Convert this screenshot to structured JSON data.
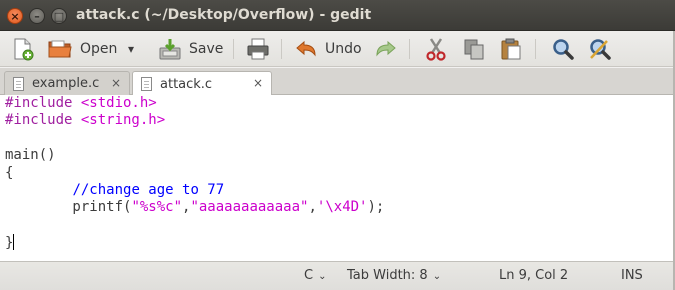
{
  "window": {
    "title": "attack.c (~/Desktop/Overflow) - gedit",
    "close_glyph": "×",
    "minimize_glyph": "–",
    "maximize_glyph": "□"
  },
  "toolbar": {
    "new_icon": "new-document-icon",
    "open_label": "Open",
    "open_dropdown": "▾",
    "save_label": "Save",
    "print_icon": "print-icon",
    "undo_label": "Undo",
    "redo_icon": "redo-icon",
    "cut_icon": "cut-icon",
    "copy_icon": "copy-icon",
    "paste_icon": "paste-icon",
    "find_icon": "find-icon",
    "replace_icon": "find-replace-icon"
  },
  "tabs": [
    {
      "label": "example.c",
      "close": "×",
      "active": false
    },
    {
      "label": "attack.c",
      "close": "×",
      "active": true
    }
  ],
  "editor": {
    "lines": [
      {
        "parts": [
          {
            "text": "#include ",
            "cls": "pp"
          },
          {
            "text": "<stdio.h>",
            "cls": "inc"
          }
        ]
      },
      {
        "parts": [
          {
            "text": "#include ",
            "cls": "pp"
          },
          {
            "text": "<string.h>",
            "cls": "inc"
          }
        ]
      },
      {
        "parts": []
      },
      {
        "parts": [
          {
            "text": "main()",
            "cls": ""
          }
        ]
      },
      {
        "parts": [
          {
            "text": "{",
            "cls": ""
          }
        ]
      },
      {
        "parts": [
          {
            "text": "        ",
            "cls": ""
          },
          {
            "text": "//change age to 77",
            "cls": "cm"
          }
        ]
      },
      {
        "parts": [
          {
            "text": "        printf(",
            "cls": ""
          },
          {
            "text": "\"%s%c\"",
            "cls": "str"
          },
          {
            "text": ",",
            "cls": ""
          },
          {
            "text": "\"aaaaaaaaaaaa\"",
            "cls": "str"
          },
          {
            "text": ",",
            "cls": ""
          },
          {
            "text": "'\\x4D'",
            "cls": "str"
          },
          {
            "text": ");",
            "cls": ""
          }
        ]
      },
      {
        "parts": []
      },
      {
        "parts": [
          {
            "text": "}",
            "cls": ""
          }
        ],
        "cursor": true
      }
    ]
  },
  "statusbar": {
    "language": "C",
    "tab_width": "Tab Width: 8",
    "position": "Ln 9, Col 2",
    "mode": "INS",
    "chevron": "⌄"
  }
}
